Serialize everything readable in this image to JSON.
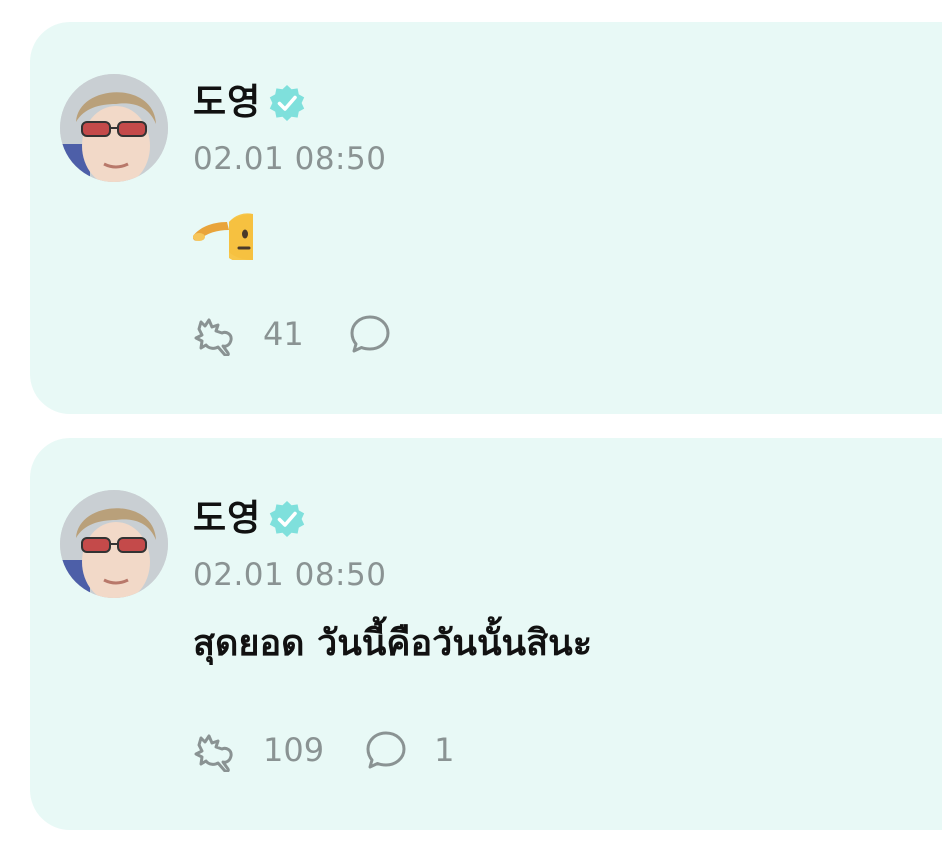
{
  "colors": {
    "card_background": "#e8f9f6",
    "verified_badge": "#7fe0dc",
    "meta_text": "#8a9393",
    "primary_text": "#111111"
  },
  "posts": [
    {
      "author": "도영",
      "verified": true,
      "timestamp": "02.01 08:50",
      "content_emoji": "saluting-face",
      "content_text": "",
      "reaction_count": "41",
      "comment_count": ""
    },
    {
      "author": "도영",
      "verified": true,
      "timestamp": "02.01 08:50",
      "content_text": "สุดยอด วันนี้คือวันนั้นสินะ",
      "reaction_count": "109",
      "comment_count": "1"
    }
  ],
  "icons": {
    "reaction": "reaction-icon",
    "comment": "comment-icon",
    "verified": "verified-badge-icon",
    "avatar": "profile-avatar"
  }
}
